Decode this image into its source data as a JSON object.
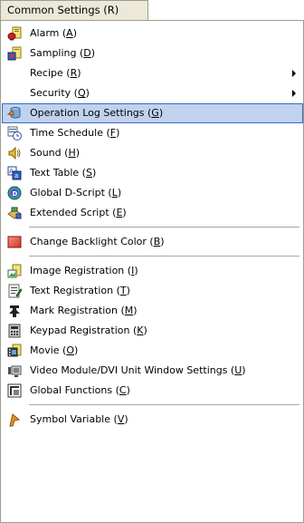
{
  "menu": {
    "header": "Common Settings (R)",
    "items": [
      {
        "pre": "Alarm (",
        "key": "A",
        "post": ")",
        "icon": "alarm-icon"
      },
      {
        "pre": "Sampling (",
        "key": "D",
        "post": ")",
        "icon": "sampling-icon"
      },
      {
        "pre": "Recipe (",
        "key": "R",
        "post": ")",
        "icon": "",
        "submenu": true
      },
      {
        "pre": "Security (",
        "key": "Q",
        "post": ")",
        "icon": "",
        "submenu": true
      },
      {
        "pre": "Operation Log Settings (",
        "key": "G",
        "post": ")",
        "icon": "operation-log-icon",
        "selected": true
      },
      {
        "pre": "Time Schedule (",
        "key": "F",
        "post": ")",
        "icon": "time-schedule-icon"
      },
      {
        "pre": "Sound (",
        "key": "H",
        "post": ")",
        "icon": "sound-icon"
      },
      {
        "pre": "Text Table (",
        "key": "S",
        "post": ")",
        "icon": "text-table-icon"
      },
      {
        "pre": "Global D-Script (",
        "key": "L",
        "post": ")",
        "icon": "global-dscript-icon"
      },
      {
        "pre": "Extended Script (",
        "key": "E",
        "post": ")",
        "icon": "extended-script-icon"
      },
      {
        "pre": "Change Backlight Color (",
        "key": "B",
        "post": ")",
        "icon": "backlight-color-icon"
      },
      {
        "pre": "Image Registration (",
        "key": "I",
        "post": ")",
        "icon": "image-registration-icon"
      },
      {
        "pre": "Text Registration (",
        "key": "T",
        "post": ")",
        "icon": "text-registration-icon"
      },
      {
        "pre": "Mark Registration (",
        "key": "M",
        "post": ")",
        "icon": "mark-registration-icon"
      },
      {
        "pre": "Keypad Registration (",
        "key": "K",
        "post": ")",
        "icon": "keypad-registration-icon"
      },
      {
        "pre": "Movie (",
        "key": "O",
        "post": ")",
        "icon": "movie-icon"
      },
      {
        "pre": "Video Module/DVI Unit Window Settings (",
        "key": "U",
        "post": ")",
        "icon": "video-module-icon"
      },
      {
        "pre": "Global Functions (",
        "key": "C",
        "post": ")",
        "icon": "global-functions-icon"
      },
      {
        "pre": "Symbol Variable (",
        "key": "V",
        "post": ")",
        "icon": "symbol-variable-icon"
      }
    ]
  },
  "colors": {
    "selection_bg": "#c1d2ee",
    "selection_border": "#316ac5",
    "header_bg": "#ece9d8"
  }
}
